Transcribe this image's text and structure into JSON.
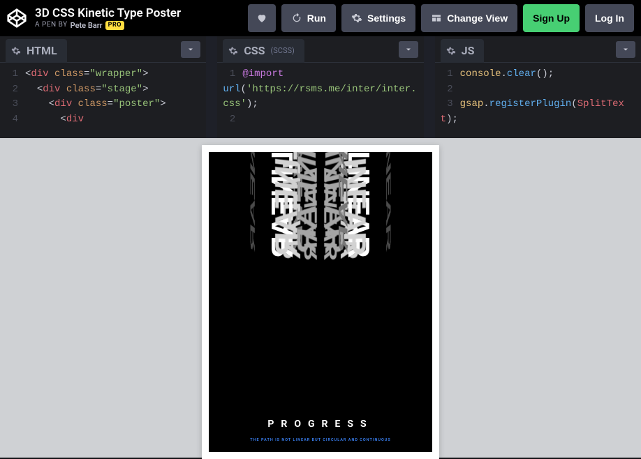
{
  "header": {
    "title": "3D CSS Kinetic Type Poster",
    "byline_prefix": "A PEN BY",
    "author": "Pete Barr",
    "pro_badge": "PRO",
    "run_label": "Run",
    "settings_label": "Settings",
    "change_view_label": "Change View",
    "signup_label": "Sign Up",
    "login_label": "Log In"
  },
  "editors": {
    "html": {
      "name": "HTML",
      "lines": [
        {
          "n": "1",
          "html": "<div class=\"wrapper\">"
        },
        {
          "n": "2",
          "html": "  <div class=\"stage\">"
        },
        {
          "n": "3",
          "html": "    <div class=\"poster\">"
        },
        {
          "n": "4",
          "html": "      <div"
        }
      ]
    },
    "css": {
      "name": "CSS",
      "preprocessor": "(SCSS)",
      "lines": [
        {
          "n": "1",
          "code": "@import url('https://rsms.me/inter/inter.css');"
        },
        {
          "n": "2",
          "code": ""
        }
      ]
    },
    "js": {
      "name": "JS",
      "lines": [
        {
          "n": "1",
          "code": "console.clear();"
        },
        {
          "n": "2",
          "code": ""
        },
        {
          "n": "3",
          "code": "gsap.registerPlugin(SplitText);"
        }
      ]
    }
  },
  "preview": {
    "poster": {
      "kinetic_word": "LINEAR",
      "title": "PROGRESS",
      "subtitle": "THE PATH IS NOT LINEAR BUT CIRCULAR AND CONTINUOUS"
    }
  }
}
